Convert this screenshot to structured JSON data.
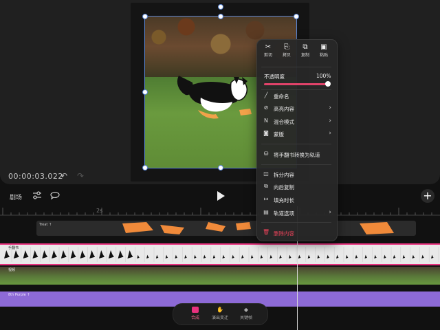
{
  "preview": {
    "timecode": "00:00:03.022",
    "undo_icon": "undo-icon",
    "redo_icon": "redo-icon"
  },
  "toolbar": {
    "script_label": "剧场",
    "adjust_icon": "sliders-icon",
    "comment_icon": "speech-bubble-icon",
    "play_icon": "play-icon",
    "add_label": "+"
  },
  "ruler": {
    "label": "2s"
  },
  "tracks": {
    "text": {
      "label": "Treat ↑"
    },
    "hand": {
      "label": "手翻书"
    },
    "video": {
      "label": "视频"
    },
    "audio": {
      "label": "8th Purple ↑"
    }
  },
  "tabs": [
    {
      "label": "合成",
      "icon": "compose-icon",
      "active": true
    },
    {
      "label": "演出变迁",
      "icon": "hand-icon",
      "active": false
    },
    {
      "label": "关键帧",
      "icon": "keyframe-icon",
      "active": false
    }
  ],
  "menu": {
    "quick_actions": [
      {
        "label": "剪切",
        "icon": "scissors-icon",
        "glyph": "✂"
      },
      {
        "label": "拷贝",
        "icon": "copy-icon",
        "glyph": "⎘"
      },
      {
        "label": "复制",
        "icon": "duplicate-icon",
        "glyph": "⧉"
      },
      {
        "label": "粘贴",
        "icon": "paste-icon",
        "glyph": "▣"
      }
    ],
    "opacity_label": "不透明度",
    "opacity_value": "100%",
    "opacity_fraction": 1.0,
    "items": [
      {
        "label": "重命名",
        "icon": "pencil-icon",
        "glyph": "╱",
        "submenu": false
      },
      {
        "label": "高亮内容",
        "icon": "highlight-icon",
        "glyph": "⊘",
        "submenu": true
      },
      {
        "label": "混合模式",
        "icon": "blend-icon",
        "glyph": "N",
        "submenu": true
      },
      {
        "label": "蒙版",
        "icon": "mask-icon",
        "glyph": "◙",
        "submenu": true
      },
      {
        "label": "将手翻书转换为轨道",
        "icon": "convert-icon",
        "glyph": "⛁",
        "submenu": false
      },
      {
        "label": "拆分内容",
        "icon": "split-icon",
        "glyph": "◫",
        "submenu": false
      },
      {
        "label": "向后复制",
        "icon": "copy-forward-icon",
        "glyph": "⧉",
        "submenu": false
      },
      {
        "label": "填充时长",
        "icon": "fill-duration-icon",
        "glyph": "↦",
        "submenu": false
      },
      {
        "label": "轨道选项",
        "icon": "track-options-icon",
        "glyph": "▤",
        "submenu": true
      },
      {
        "label": "删除内容",
        "icon": "trash-icon",
        "glyph": "🗑",
        "submenu": false,
        "destructive": true
      }
    ],
    "accent_color": "#e2436a"
  }
}
